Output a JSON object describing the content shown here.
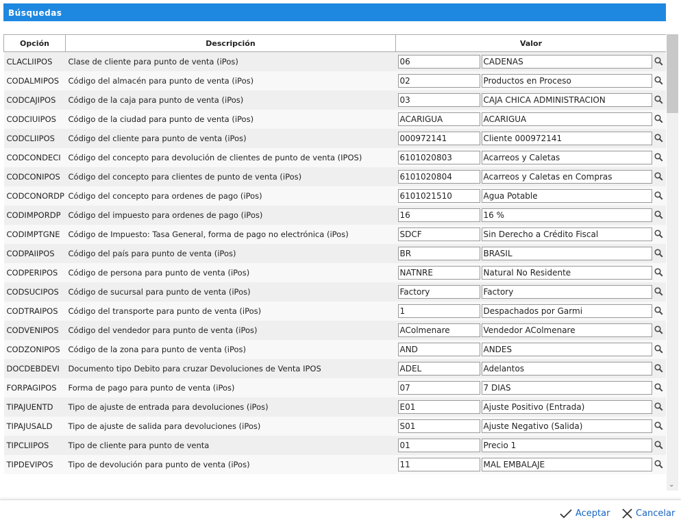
{
  "title": "Búsquedas",
  "columns": {
    "option": "Opción",
    "description": "Descripción",
    "value": "Valor"
  },
  "rows": [
    {
      "option": "CLACLIIPOS",
      "description": "Clase de cliente para punto de venta (iPos)",
      "code": "06",
      "name": "CADENAS"
    },
    {
      "option": "CODALMIPOS",
      "description": "Código del almacén para punto de venta (iPos)",
      "code": "02",
      "name": "Productos en Proceso"
    },
    {
      "option": "CODCAJIPOS",
      "description": "Código de la caja para punto de venta (iPos)",
      "code": "03",
      "name": "CAJA CHICA ADMINISTRACION"
    },
    {
      "option": "CODCIUIPOS",
      "description": "Código de la ciudad para punto de venta (iPos)",
      "code": "ACARIGUA",
      "name": "ACARIGUA"
    },
    {
      "option": "CODCLIIPOS",
      "description": "Código del cliente para punto de venta (iPos)",
      "code": "000972141",
      "name": "Cliente 000972141"
    },
    {
      "option": "CODCONDECI",
      "description": "Código del concepto para devolución de clientes de punto de venta (IPOS)",
      "code": "6101020803",
      "name": "Acarreos y Caletas"
    },
    {
      "option": "CODCONIPOS",
      "description": "Código del concepto para clientes de punto de venta (iPos)",
      "code": "6101020804",
      "name": "Acarreos y Caletas en Compras"
    },
    {
      "option": "CODCONORDP",
      "description": "Código del concepto para ordenes de pago (iPos)",
      "code": "6101021510",
      "name": "Agua Potable"
    },
    {
      "option": "CODIMPORDP",
      "description": "Código del impuesto para ordenes de pago (iPos)",
      "code": "16",
      "name": "16 %"
    },
    {
      "option": "CODIMPTGNE",
      "description": "Código de Impuesto: Tasa General, forma de pago no electrónica (iPos)",
      "code": "SDCF",
      "name": "Sin Derecho a Crédito Fiscal"
    },
    {
      "option": "CODPAIIPOS",
      "description": "Código del país para punto de venta (iPos)",
      "code": "BR",
      "name": "BRASIL"
    },
    {
      "option": "CODPERIPOS",
      "description": "Código de persona para punto de venta (iPos)",
      "code": "NATNRE",
      "name": "Natural No Residente"
    },
    {
      "option": "CODSUCIPOS",
      "description": "Código de sucursal para punto de venta (iPos)",
      "code": "Factory",
      "name": "Factory"
    },
    {
      "option": "CODTRAIPOS",
      "description": "Código del transporte para punto de venta (iPos)",
      "code": "1",
      "name": "Despachados por Garmi"
    },
    {
      "option": "CODVENIPOS",
      "description": "Código del vendedor para punto de venta (iPos)",
      "code": "AColmenare",
      "name": "Vendedor AColmenare"
    },
    {
      "option": "CODZONIPOS",
      "description": "Código de la zona para punto de venta (iPos)",
      "code": "AND",
      "name": "ANDES"
    },
    {
      "option": "DOCDEBDEVI",
      "description": "Documento tipo Debito para cruzar Devoluciones de Venta IPOS",
      "code": "ADEL",
      "name": "Adelantos"
    },
    {
      "option": "FORPAGIPOS",
      "description": "Forma de pago para punto de venta (iPos)",
      "code": "07",
      "name": "7 DIAS"
    },
    {
      "option": "TIPAJUENTD",
      "description": "Tipo de ajuste de entrada para devoluciones (iPos)",
      "code": "E01",
      "name": "Ajuste Positivo (Entrada)"
    },
    {
      "option": "TIPAJUSALD",
      "description": "Tipo de ajuste de salida para devoluciones (iPos)",
      "code": "S01",
      "name": "Ajuste Negativo (Salida)"
    },
    {
      "option": "TIPCLIIPOS",
      "description": "Tipo de cliente para punto de venta",
      "code": "01",
      "name": "Precio 1"
    },
    {
      "option": "TIPDEVIPOS",
      "description": "Tipo de devolución para punto de venta (iPos)",
      "code": "11",
      "name": "MAL EMBALAJE"
    }
  ],
  "footer": {
    "accept": "Aceptar",
    "cancel": "Cancelar"
  }
}
